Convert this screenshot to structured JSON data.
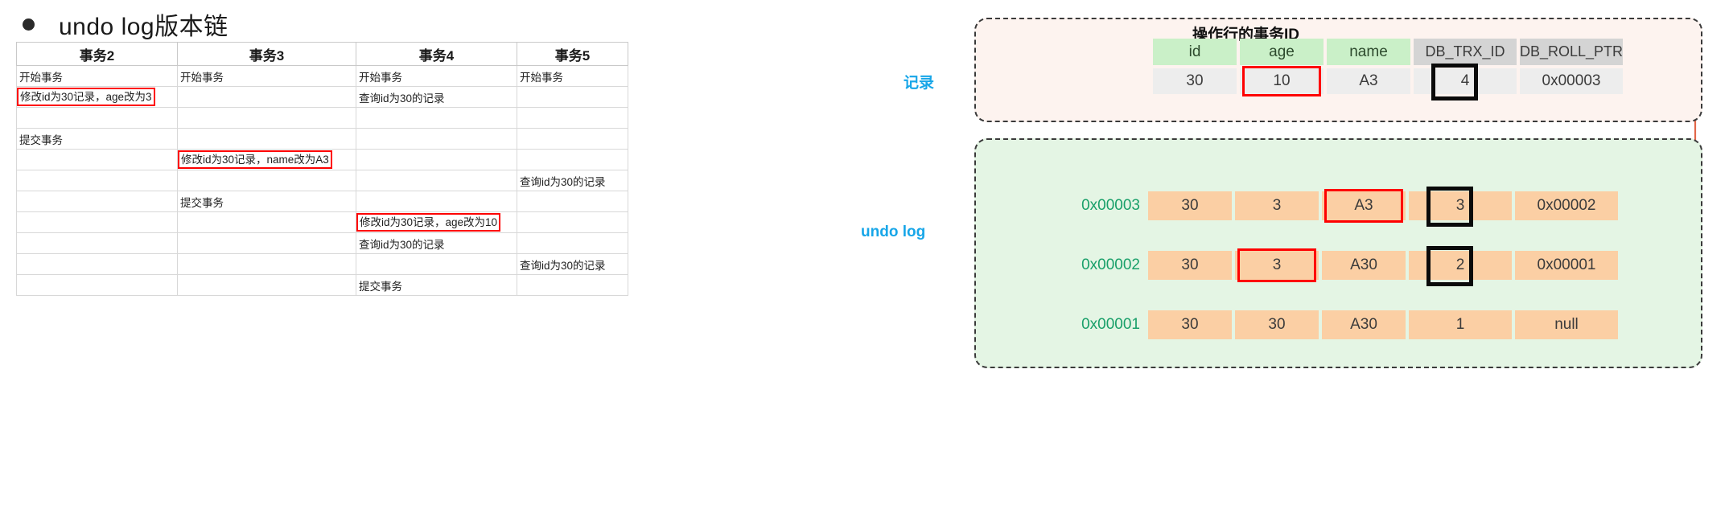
{
  "heading": {
    "bullet_label": "bullet-point",
    "text": "undo log版本链"
  },
  "txn_table": {
    "headers": [
      "事务2",
      "事务3",
      "事务4",
      "事务5"
    ],
    "rows": [
      [
        {
          "text": "开始事务",
          "highlight": false
        },
        {
          "text": "开始事务",
          "highlight": false
        },
        {
          "text": "开始事务",
          "highlight": false
        },
        {
          "text": "开始事务",
          "highlight": false
        }
      ],
      [
        {
          "text": "修改id为30记录，age改为3",
          "highlight": true
        },
        {
          "text": "",
          "highlight": false
        },
        {
          "text": "查询id为30的记录",
          "highlight": false
        },
        {
          "text": "",
          "highlight": false
        }
      ],
      [
        {
          "text": "",
          "highlight": false
        },
        {
          "text": "",
          "highlight": false
        },
        {
          "text": "",
          "highlight": false
        },
        {
          "text": "",
          "highlight": false
        }
      ],
      [
        {
          "text": "提交事务",
          "highlight": false
        },
        {
          "text": "",
          "highlight": false
        },
        {
          "text": "",
          "highlight": false
        },
        {
          "text": "",
          "highlight": false
        }
      ],
      [
        {
          "text": "",
          "highlight": false
        },
        {
          "text": "修改id为30记录，name改为A3",
          "highlight": true
        },
        {
          "text": "",
          "highlight": false
        },
        {
          "text": "",
          "highlight": false
        }
      ],
      [
        {
          "text": "",
          "highlight": false
        },
        {
          "text": "",
          "highlight": false
        },
        {
          "text": "",
          "highlight": false
        },
        {
          "text": "查询id为30的记录",
          "highlight": false
        }
      ],
      [
        {
          "text": "",
          "highlight": false
        },
        {
          "text": "提交事务",
          "highlight": false
        },
        {
          "text": "",
          "highlight": false
        },
        {
          "text": "",
          "highlight": false
        }
      ],
      [
        {
          "text": "",
          "highlight": false
        },
        {
          "text": "",
          "highlight": false
        },
        {
          "text": "修改id为30记录，age改为10",
          "highlight": true
        },
        {
          "text": "",
          "highlight": false
        }
      ],
      [
        {
          "text": "",
          "highlight": false
        },
        {
          "text": "",
          "highlight": false
        },
        {
          "text": "查询id为30的记录",
          "highlight": false
        },
        {
          "text": "",
          "highlight": false
        }
      ],
      [
        {
          "text": "",
          "highlight": false
        },
        {
          "text": "",
          "highlight": false
        },
        {
          "text": "",
          "highlight": false
        },
        {
          "text": "查询id为30的记录",
          "highlight": false
        }
      ],
      [
        {
          "text": "",
          "highlight": false
        },
        {
          "text": "",
          "highlight": false
        },
        {
          "text": "提交事务",
          "highlight": false
        },
        {
          "text": "",
          "highlight": false
        }
      ]
    ]
  },
  "diagram": {
    "record_label": "记录",
    "undolog_label": "undo log",
    "trx_caption": "操作行的事务ID",
    "record_headers": [
      "id",
      "age",
      "name",
      "DB_TRX_ID",
      "DB_ROLL_PTR"
    ],
    "record_values": [
      "30",
      "10",
      "A3",
      "4",
      "0x00003"
    ],
    "undo_rows": [
      {
        "ptr": "0x00003",
        "values": [
          "30",
          "3",
          "A3",
          "3",
          "0x00002"
        ]
      },
      {
        "ptr": "0x00002",
        "values": [
          "30",
          "3",
          "A30",
          "2",
          "0x00001"
        ]
      },
      {
        "ptr": "0x00001",
        "values": [
          "30",
          "30",
          "A30",
          "1",
          "null"
        ]
      }
    ],
    "colors": {
      "record_bg": "#fdf3ef",
      "undo_bg": "#e4f5e4",
      "header_green": "#caf0c8",
      "header_gray": "#d4d4d4",
      "undo_cell": "#fbcfa4",
      "highlight_red": "#fe0000",
      "highlight_black": "#0a0a0a",
      "label_blue": "#17a6e8",
      "ptr_green": "#1aa06a",
      "arrow": "#e2674a"
    }
  }
}
